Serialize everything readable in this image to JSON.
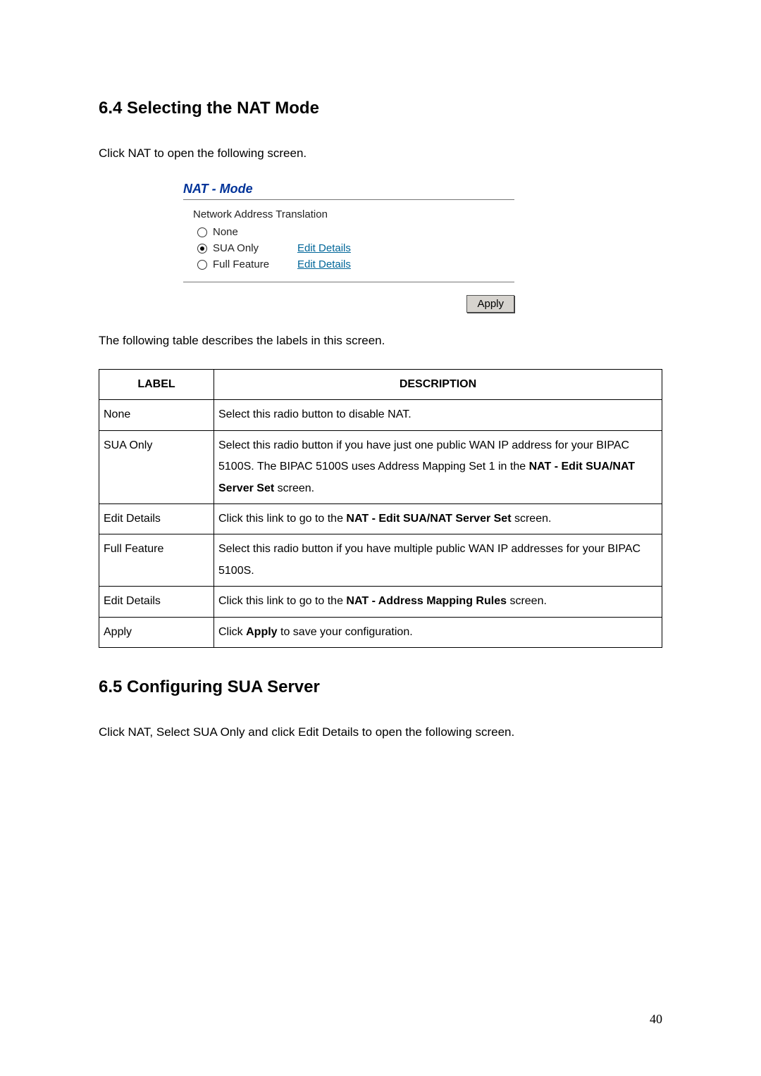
{
  "section1": {
    "heading": "6.4 Selecting the NAT Mode",
    "intro": "Click NAT to open the following screen."
  },
  "nat_panel": {
    "title": "NAT - Mode",
    "group_label": "Network Address Translation",
    "options": {
      "none": "None",
      "sua_only": "SUA Only",
      "full_feature": "Full Feature"
    },
    "edit_link": "Edit Details",
    "apply": "Apply",
    "selected": "sua_only"
  },
  "table_intro": "The following table describes the labels in this screen.",
  "table": {
    "headers": {
      "label": "LABEL",
      "desc": "DESCRIPTION"
    },
    "rows": [
      {
        "label": "None",
        "desc_parts": [
          "Select this radio button to disable NAT."
        ]
      },
      {
        "label": "SUA Only",
        "desc_parts": [
          "Select this radio button if you have just one public WAN IP address for your BIPAC 5100S. The BIPAC 5100S uses Address Mapping Set 1 in the ",
          "NAT - Edit SUA/NAT Server Set",
          " screen."
        ],
        "bold_idx": [
          1
        ]
      },
      {
        "label": "Edit Details",
        "desc_parts": [
          "Click this link to go to the ",
          "NAT - Edit SUA/NAT Server Set",
          " screen."
        ],
        "bold_idx": [
          1
        ]
      },
      {
        "label": "Full Feature",
        "desc_parts": [
          "Select this radio button if you have multiple public WAN IP addresses for your BIPAC 5100S."
        ]
      },
      {
        "label": "Edit Details",
        "desc_parts": [
          "Click this link to go to the ",
          "NAT - Address Mapping Rules",
          " screen."
        ],
        "bold_idx": [
          1
        ]
      },
      {
        "label": "Apply",
        "desc_parts": [
          "Click ",
          "Apply",
          " to save your configuration."
        ],
        "bold_idx": [
          1
        ]
      }
    ]
  },
  "section2": {
    "heading": "6.5 Configuring SUA Server",
    "intro": "Click NAT, Select SUA Only and click Edit Details to open the following screen."
  },
  "page_number": "40"
}
